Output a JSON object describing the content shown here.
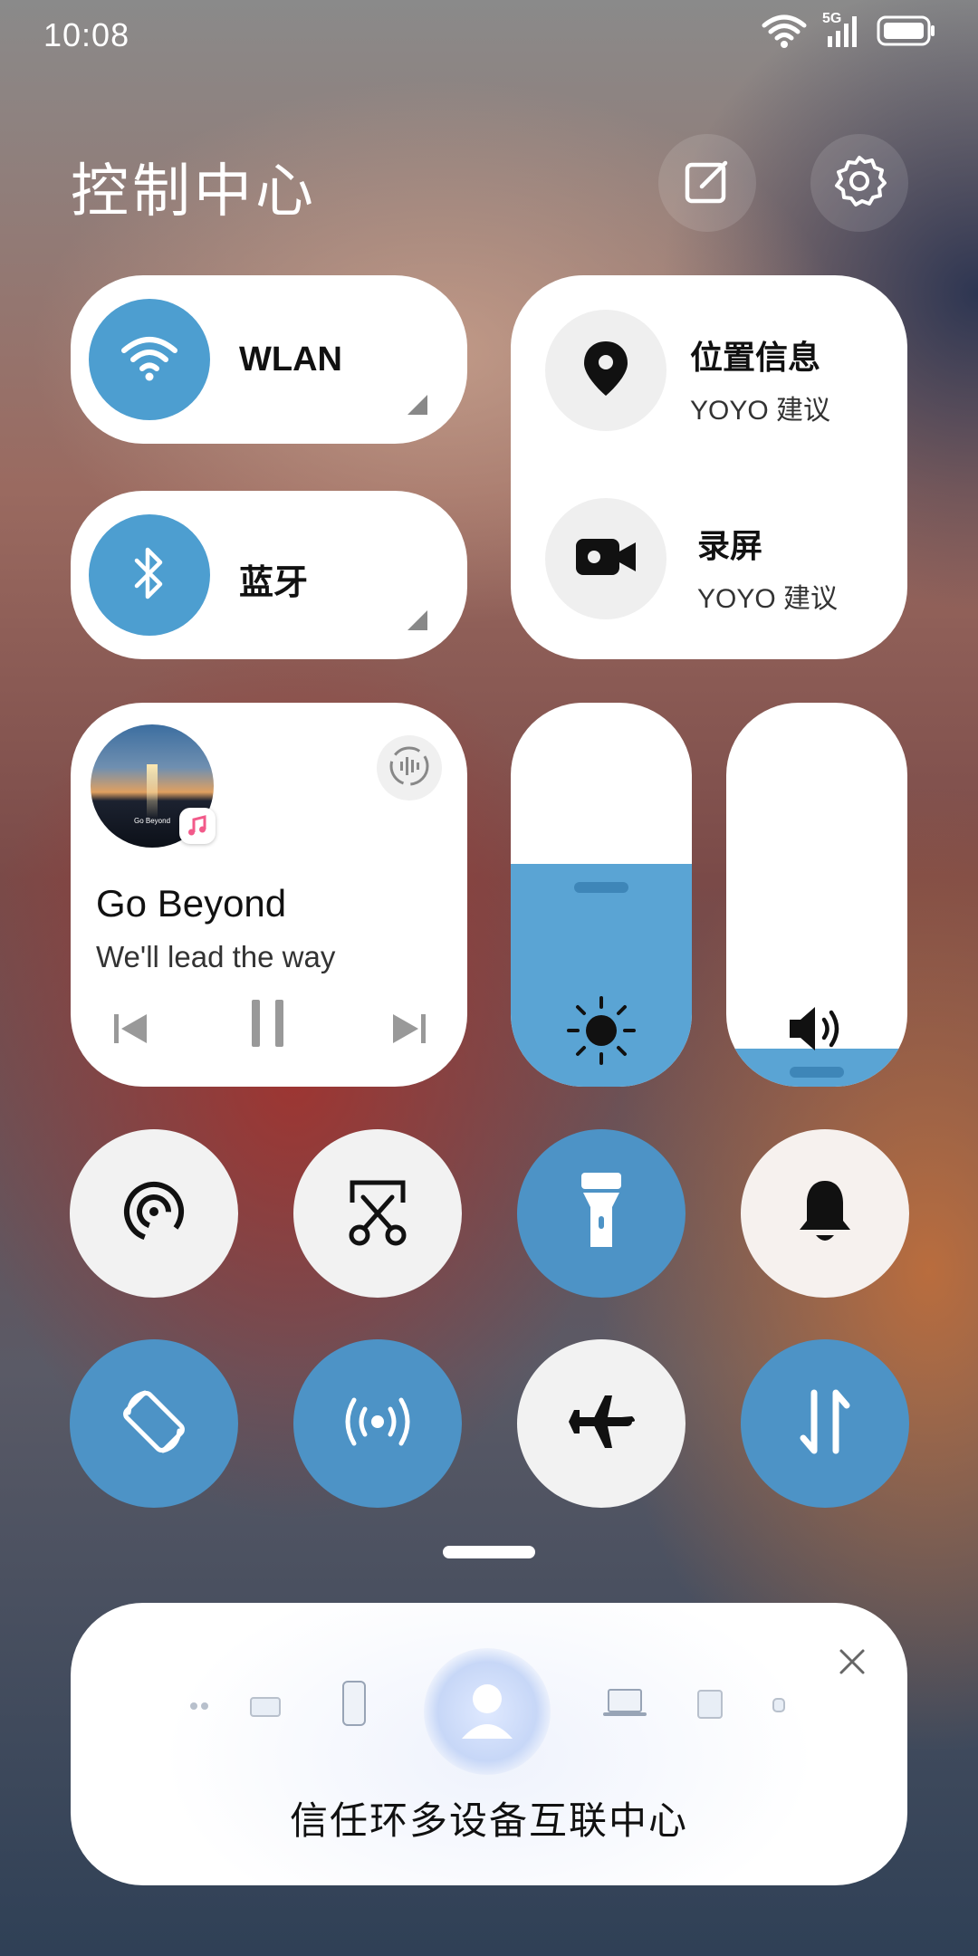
{
  "status_bar": {
    "time": "10:08",
    "network": "5G",
    "icons": [
      "wifi-icon",
      "signal-icon",
      "battery-icon"
    ]
  },
  "header": {
    "title": "控制中心",
    "edit_icon": "edit-icon",
    "settings_icon": "gear-icon"
  },
  "tiles": {
    "wlan": {
      "label": "WLAN",
      "active": true
    },
    "bluetooth": {
      "label": "蓝牙",
      "active": true
    },
    "location": {
      "title": "位置信息",
      "subtitle": "YOYO 建议"
    },
    "screen_record": {
      "title": "录屏",
      "subtitle": "YOYO 建议"
    }
  },
  "media": {
    "title": "Go Beyond",
    "subtitle": "We'll lead the way",
    "album_text": "Go Beyond",
    "app_icon": "music-icon",
    "state": "playing"
  },
  "sliders": {
    "brightness": {
      "level": 0.58,
      "icon": "sun-icon"
    },
    "volume": {
      "level": 0.1,
      "icon": "speaker-icon"
    }
  },
  "quick_toggles": [
    {
      "name": "hotspot-share",
      "icon": "broadcast-icon",
      "active": false
    },
    {
      "name": "screenshot",
      "icon": "scissors-screenshot-icon",
      "active": false
    },
    {
      "name": "flashlight",
      "icon": "flashlight-icon",
      "active": true
    },
    {
      "name": "ring-mode",
      "icon": "bell-icon",
      "active": false
    },
    {
      "name": "auto-rotate",
      "icon": "rotate-icon",
      "active": true
    },
    {
      "name": "nfc",
      "icon": "wireless-signal-icon",
      "active": true
    },
    {
      "name": "airplane-mode",
      "icon": "airplane-icon",
      "active": false
    },
    {
      "name": "mobile-data",
      "icon": "data-arrows-icon",
      "active": true
    }
  ],
  "trust_center": {
    "title": "信任环多设备互联中心",
    "close_icon": "close-icon"
  },
  "colors": {
    "accent_blue": "#4d9ed0",
    "card_white": "#ffffff"
  }
}
